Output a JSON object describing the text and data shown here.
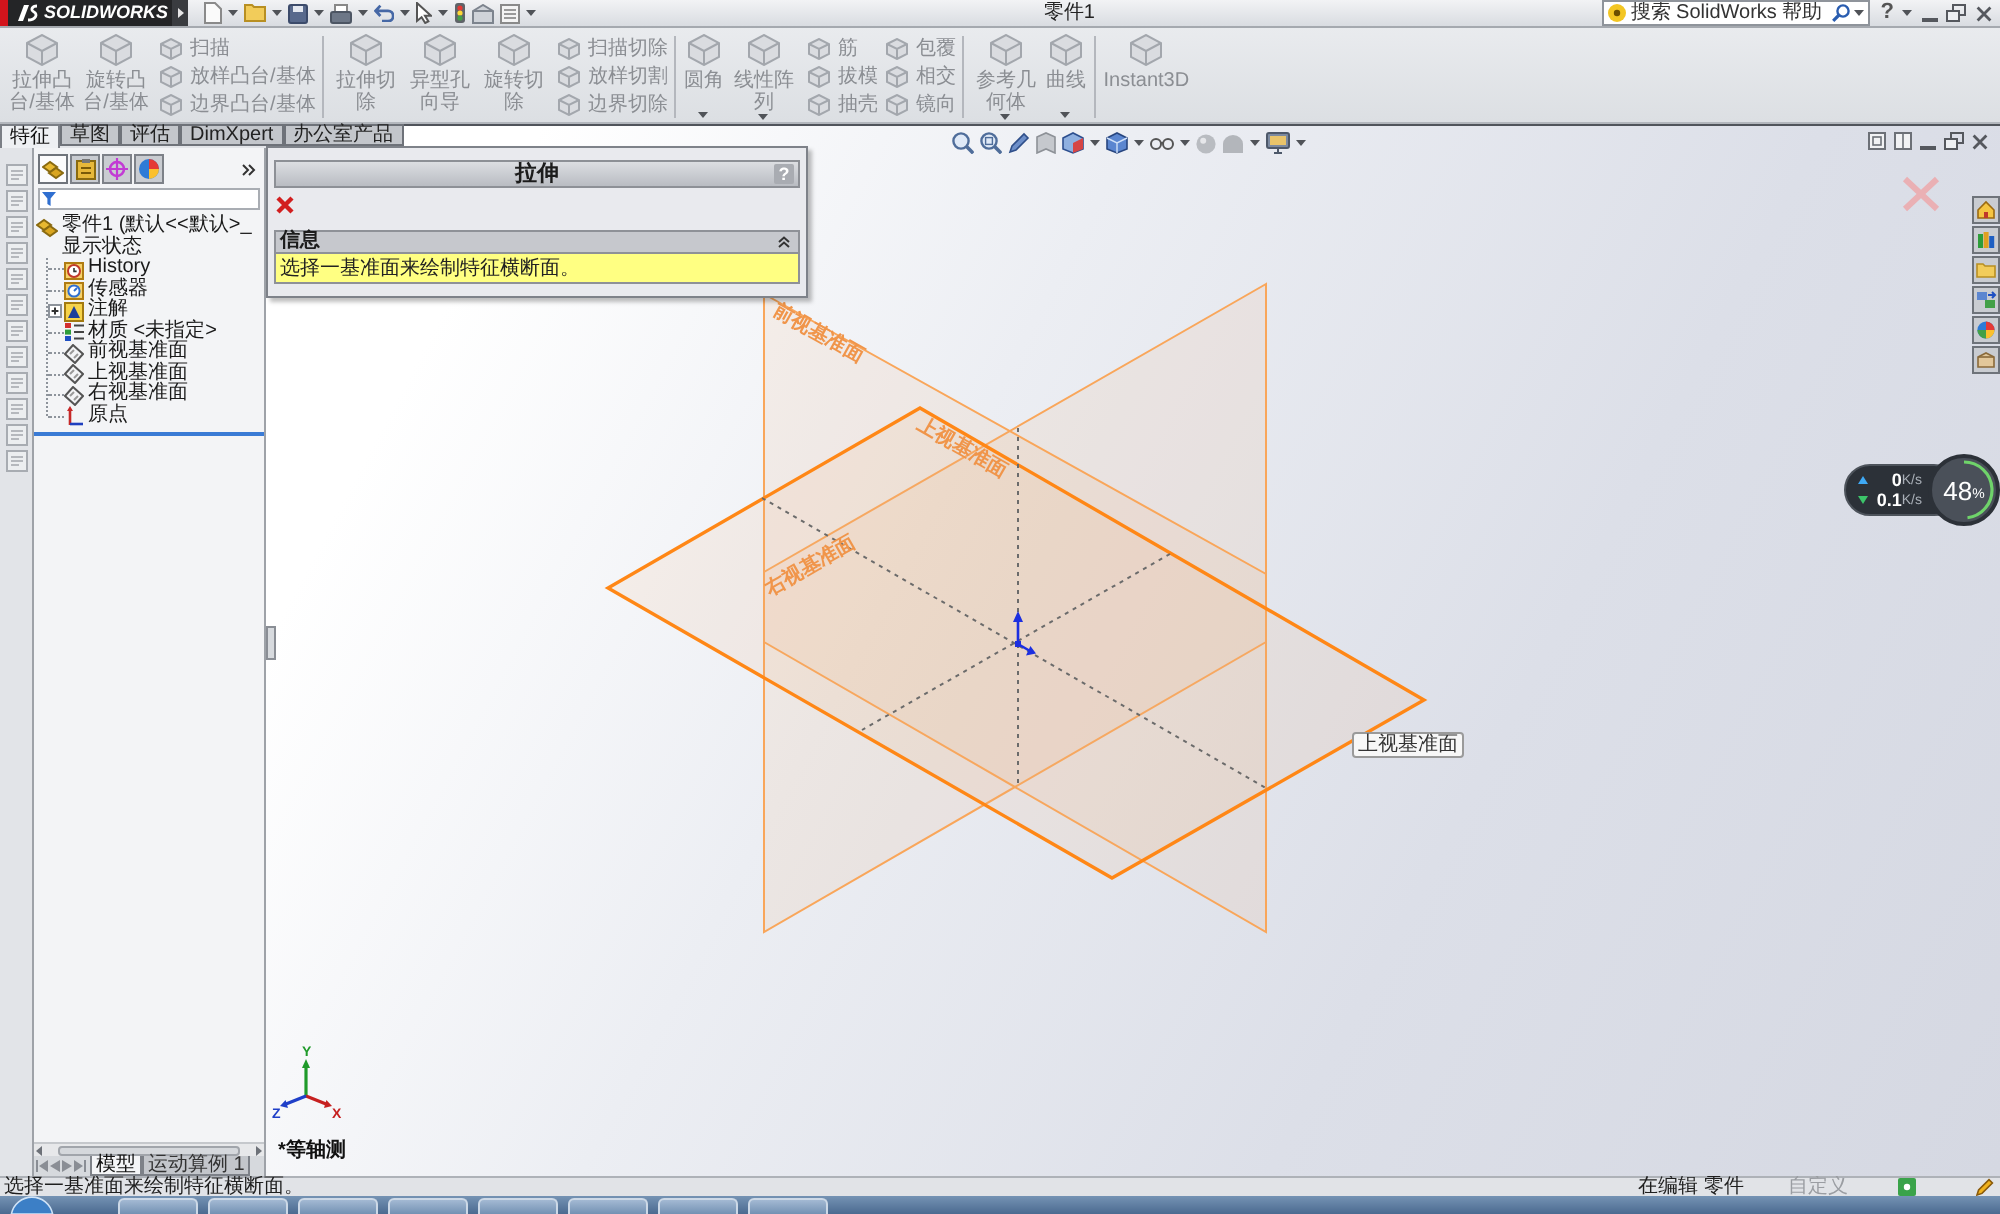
{
  "title_bar": {
    "logo": "SOLIDWORKS",
    "title": "零件1",
    "search": {
      "placeholder": "搜索 SolidWorks 帮助"
    },
    "help": "?"
  },
  "command_manager": {
    "groups": [
      {
        "large": [
          {
            "label": "拉伸凸台/基体",
            "disabled": true,
            "dropdown": false
          },
          {
            "label": "旋转凸台/基体",
            "disabled": true,
            "dropdown": false
          }
        ],
        "small": [
          [
            {
              "label": "扫描",
              "disabled": true
            },
            {
              "label": "放样凸台/基体",
              "disabled": true
            },
            {
              "label": "边界凸台/基体",
              "disabled": true
            }
          ]
        ]
      },
      {
        "large": [
          {
            "label": "拉伸切除",
            "disabled": true,
            "dropdown": false
          },
          {
            "label": "异型孔向导",
            "disabled": true,
            "dropdown": false
          },
          {
            "label": "旋转切除",
            "disabled": true,
            "dropdown": false
          }
        ],
        "small": [
          [
            {
              "label": "扫描切除",
              "disabled": true
            },
            {
              "label": "放样切割",
              "disabled": true
            },
            {
              "label": "边界切除",
              "disabled": true
            }
          ]
        ]
      },
      {
        "large": [
          {
            "label": "圆角",
            "disabled": true,
            "dropdown": true
          },
          {
            "label": "线性阵列",
            "disabled": true,
            "dropdown": true
          }
        ],
        "small": [
          [
            {
              "label": "筋",
              "disabled": true
            },
            {
              "label": "拔模",
              "disabled": true
            },
            {
              "label": "抽壳",
              "disabled": true
            }
          ],
          [
            {
              "label": "包覆",
              "disabled": true
            },
            {
              "label": "相交",
              "disabled": true
            },
            {
              "label": "镜向",
              "disabled": true
            }
          ]
        ]
      },
      {
        "large": [
          {
            "label": "参考几何体",
            "disabled": true,
            "dropdown": true
          },
          {
            "label": "曲线",
            "disabled": true,
            "dropdown": true
          }
        ]
      },
      {
        "large": [
          {
            "label": "Instant3D",
            "disabled": true,
            "dropdown": false
          }
        ]
      }
    ]
  },
  "command_tabs": [
    {
      "label": "特征",
      "selected": true
    },
    {
      "label": "草图",
      "selected": false
    },
    {
      "label": "评估",
      "selected": false
    },
    {
      "label": "DimXpert",
      "selected": false
    },
    {
      "label": "办公室产品",
      "selected": false
    }
  ],
  "feature_manager": {
    "panel_tabs": [
      {
        "kind": "tree",
        "selected": true
      },
      {
        "kind": "property",
        "selected": false
      },
      {
        "kind": "configuration",
        "selected": false
      },
      {
        "kind": "display",
        "selected": false
      }
    ],
    "tree": [
      {
        "label": "零件1 (默认<<默认>_显示状态",
        "kind": "part",
        "children": [
          {
            "label": "History",
            "kind": "history"
          },
          {
            "label": "传感器",
            "kind": "sensor"
          },
          {
            "label": "注解",
            "kind": "annotation",
            "expanded": false
          },
          {
            "label": "材质 <未指定>",
            "kind": "material"
          },
          {
            "label": "前视基准面",
            "kind": "plane"
          },
          {
            "label": "上视基准面",
            "kind": "plane"
          },
          {
            "label": "右视基准面",
            "kind": "plane"
          },
          {
            "label": "原点",
            "kind": "origin"
          }
        ]
      }
    ],
    "bottom_tabs": [
      {
        "label": "模型",
        "selected": true
      },
      {
        "label": "运动算例 1",
        "selected": false
      }
    ]
  },
  "property_manager": {
    "title": "拉伸",
    "help": "?",
    "sections": [
      {
        "title": "信息",
        "expanded": true,
        "message": "选择一基准面来绘制特征横断面。"
      }
    ]
  },
  "viewport": {
    "planes": [
      {
        "kind": "front",
        "label": "前视基准面",
        "highlighted": false
      },
      {
        "kind": "top",
        "label": "上视基准面",
        "highlighted": true
      },
      {
        "kind": "right",
        "label": "右视基准面",
        "highlighted": false
      }
    ],
    "tooltip": "上视基准面",
    "triad": {
      "x": "X",
      "y": "Y",
      "z": "Z"
    },
    "view_label": "*等轴测"
  },
  "network_monitor": {
    "upload": {
      "value": "0",
      "unit": "K/s"
    },
    "download": {
      "value": "0.1",
      "unit": "K/s"
    },
    "memory": {
      "value": "48",
      "unit": "%",
      "level": 0.48
    }
  },
  "status_bar": {
    "message": "选择一基准面来绘制特征横断面。",
    "mode": "在编辑 零件",
    "custom": {
      "label": "自定义",
      "disabled": true
    }
  }
}
